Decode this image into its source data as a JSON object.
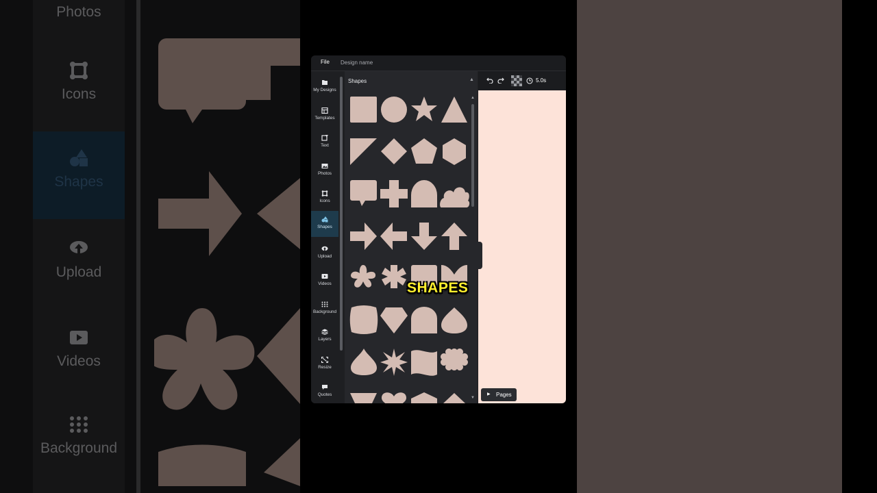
{
  "background": {
    "rail_items": [
      "Photos",
      "Icons",
      "Shapes",
      "Upload",
      "Videos",
      "Background"
    ],
    "colors": {
      "left_bg": "#0e0e0f",
      "right_bg": "#4d4341",
      "shape_fill": "#5e504b"
    }
  },
  "topbar": {
    "file_label": "File",
    "design_name": "Design name"
  },
  "nav": {
    "items": [
      {
        "label": "My Designs",
        "icon": "folder-icon"
      },
      {
        "label": "Templates",
        "icon": "templates-icon"
      },
      {
        "label": "Text",
        "icon": "text-icon"
      },
      {
        "label": "Photos",
        "icon": "photo-icon"
      },
      {
        "label": "Icons",
        "icon": "icons-icon"
      },
      {
        "label": "Shapes",
        "icon": "shapes-icon",
        "active": true
      },
      {
        "label": "Upload",
        "icon": "upload-icon"
      },
      {
        "label": "Videos",
        "icon": "video-icon"
      },
      {
        "label": "Background",
        "icon": "background-grid-icon"
      },
      {
        "label": "Layers",
        "icon": "layers-icon"
      },
      {
        "label": "Resize",
        "icon": "resize-icon"
      },
      {
        "label": "Quotes",
        "icon": "quote-icon"
      }
    ]
  },
  "panel": {
    "title": "Shapes",
    "shapes": [
      "square",
      "circle",
      "star",
      "triangle",
      "right-triangle",
      "diamond",
      "pentagon",
      "hexagon",
      "speech-bubble",
      "plus",
      "arch",
      "cloud",
      "arrow-right",
      "arrow-left",
      "arrow-down",
      "arrow-up",
      "flower",
      "asterisk",
      "square-partial",
      "bow",
      "barrel",
      "gem",
      "arch-tall",
      "teardrop-round",
      "drop",
      "starburst",
      "wave-flag",
      "flower-8",
      "trapezoid",
      "heart",
      "house-shape",
      "triangle-small"
    ],
    "colors": {
      "shape_fill": "#d4bcb3",
      "panel_bg": "#26272b"
    }
  },
  "toolbar": {
    "duration": "5.0s",
    "pages_label": "Pages"
  },
  "canvas": {
    "color": "#fde3d9"
  },
  "caption": {
    "text": "SHAPES",
    "color": "#ffef2d"
  }
}
